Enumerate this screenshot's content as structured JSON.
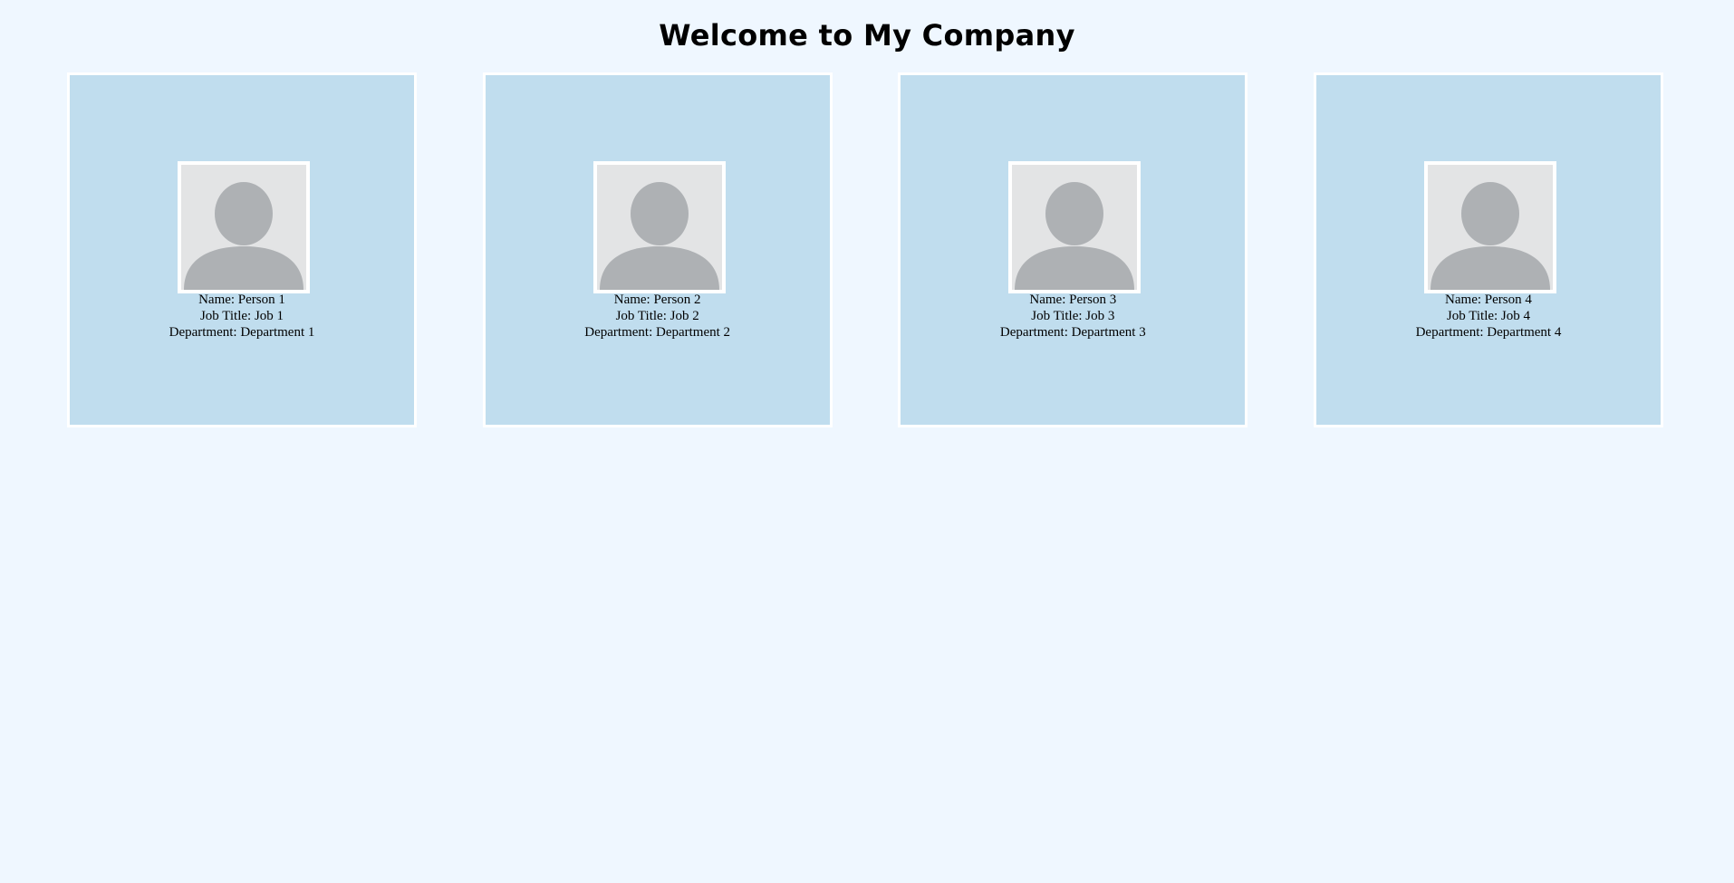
{
  "page": {
    "title": "Welcome to My Company",
    "background_color": "#eff7ff",
    "card_color": "#c0ddee",
    "avatar_icon": "user-silhouette-icon"
  },
  "employees": [
    {
      "name": "Name: Person 1",
      "job_title": "Job Title: Job 1",
      "department": "Department: Department 1"
    },
    {
      "name": "Name: Person 2",
      "job_title": "Job Title: Job 2",
      "department": "Department: Department 2"
    },
    {
      "name": "Name: Person 3",
      "job_title": "Job Title: Job 3",
      "department": "Department: Department 3"
    },
    {
      "name": "Name: Person 4",
      "job_title": "Job Title: Job 4",
      "department": "Department: Department 4"
    }
  ]
}
